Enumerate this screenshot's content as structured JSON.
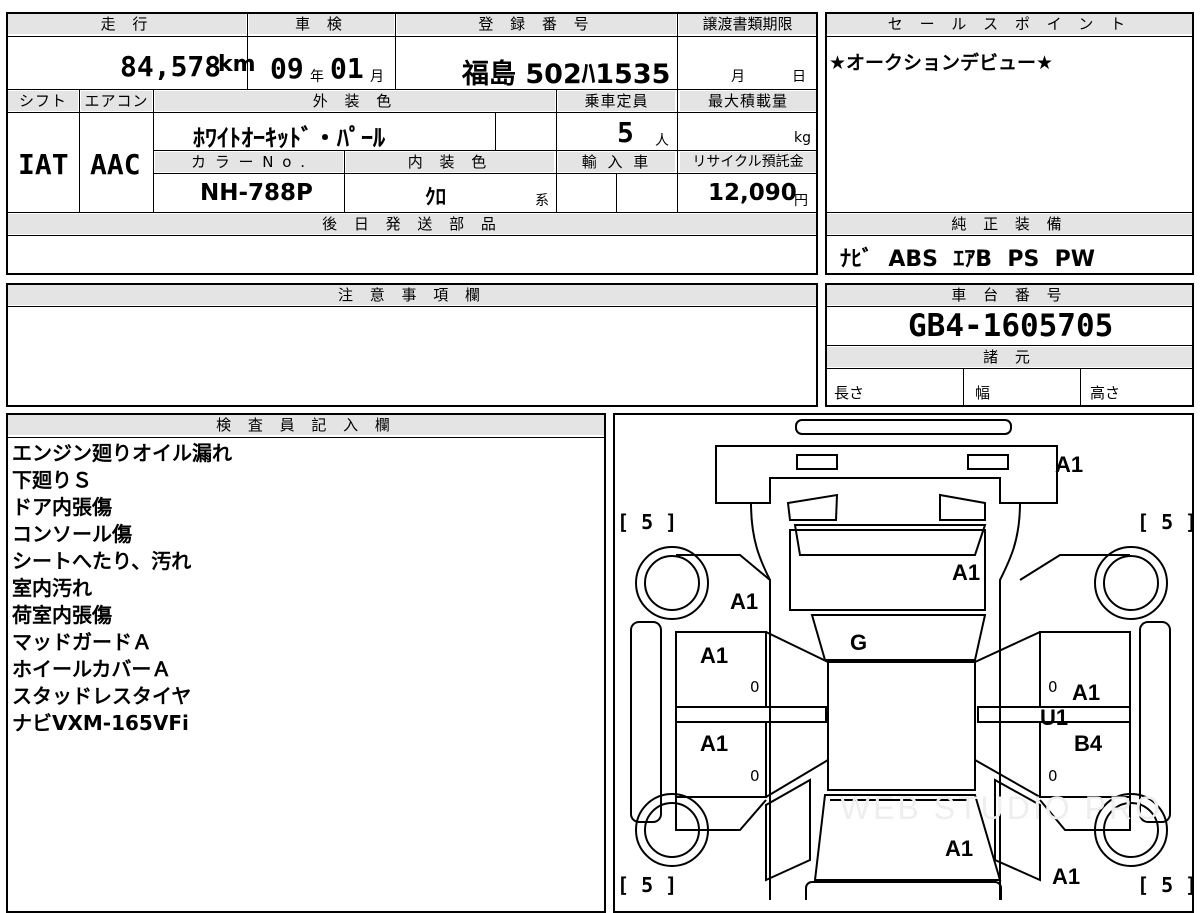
{
  "header": {
    "mileage_label": "走 行",
    "inspection_label": "車 検",
    "reg_label": "登 録 番 号",
    "transfer_label": "譲渡書類期限",
    "shift_label": "シフト",
    "ac_label": "エアコン",
    "exterior_label": "外 装 色",
    "capacity_label": "乗車定員",
    "maxload_label": "最大積載量",
    "colorno_label": "カ ラ ー N o .",
    "interior_label": "内 装 色",
    "import_label": "輸 入 車",
    "recycle_label": "リサイクル預託金",
    "later_parts_label": "後 日 発 送 部 品",
    "caution_label": "注 意 事 項 欄",
    "inspector_label": "検 査 員 記 入 欄",
    "sales_label": "セ ー ル ス ポ イ ン ト",
    "equipment_label": "純 正 装 備",
    "chassis_label": "車 台 番 号",
    "specs_label": "諸 元"
  },
  "vehicle": {
    "mileage": "84,578",
    "mileage_unit": "km",
    "inspection_year": "09",
    "year_unit": "年",
    "inspection_month": "01",
    "month_unit": "月",
    "registration": "福島 502ﾊ1535",
    "transfer_month_unit": "月",
    "transfer_day_unit": "日",
    "shift": "IAT",
    "aircon": "AAC",
    "exterior_color": "ﾎﾜｲﾄｵｰｷｯﾄﾞ・ﾊﾟｰﾙ",
    "capacity": "5",
    "capacity_unit": "人",
    "maxload_unit": "kg",
    "color_no": "NH-788P",
    "interior_color": "ｸﾛ",
    "interior_suffix": "系",
    "recycle": "12,090",
    "recycle_unit": "円",
    "sales_point": "★オークションデビュー★",
    "equipment": "ﾅﾋﾞ  ABS  ｴｱB  PS  PW",
    "chassis_no": "GB4-1605705",
    "spec_length": "長さ",
    "spec_width": "幅",
    "spec_height": "高さ"
  },
  "inspector_notes": [
    "エンジン廻りオイル漏れ",
    "下廻りＳ",
    "ドア内張傷",
    "コンソール傷",
    "シートへたり、汚れ",
    "室内汚れ",
    "荷室内張傷",
    "マッドガードＡ",
    "ホイールカバーＡ",
    "スタッドレスタイヤ",
    "ナビVXM-165VFi"
  ],
  "diagram": {
    "marks": {
      "rear_top": "A1",
      "roof": "A1",
      "left_front_fender": "A1",
      "windshield": "G",
      "left_front_door": "A1",
      "left_rear_door": "A1",
      "right_front_door": "A1",
      "right_rocker": "U1",
      "right_rear_door": "B4",
      "hood": "A1",
      "front_right": "A1"
    },
    "tire_tl": "[ 5 ]",
    "tire_tr": "[ 5 ]",
    "tire_bl": "[ 5 ]",
    "tire_br": "[ 5 ]",
    "zero": "0",
    "watermark": "WEB STUDIO PRO"
  }
}
